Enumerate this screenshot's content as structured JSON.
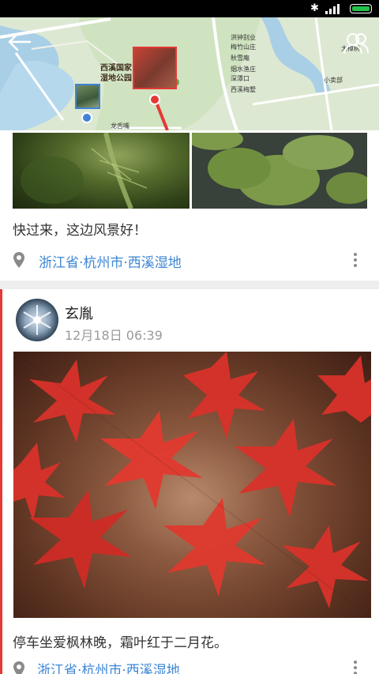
{
  "map": {
    "park_label_line1": "西溪国家",
    "park_label_line2": "湿地公园",
    "labels": [
      "洪钟别业",
      "梅竹山庄",
      "秋雪庵",
      "烟水渔庄",
      "深潭口",
      "小卖部",
      "西溪梅墅",
      "龙舌嘴",
      "大樟树"
    ]
  },
  "post1": {
    "text": "快过来，这边风景好！",
    "location": "浙江省·杭州市·西溪湿地"
  },
  "post2": {
    "username": "玄胤",
    "timestamp": "12月18日 06:39",
    "text": "停车坐爱枫林晚，霜叶红于二月花。",
    "location": "浙江省·杭州市·西溪湿地"
  },
  "colors": {
    "accent_red": "#e53935",
    "link_blue": "#3d86d4",
    "battery_green": "#23c04a"
  },
  "icons": [
    "bluetooth-icon",
    "signal-icon",
    "battery-icon",
    "back-arrow-icon",
    "people-icon",
    "location-pin-icon",
    "more-vert-icon"
  ]
}
